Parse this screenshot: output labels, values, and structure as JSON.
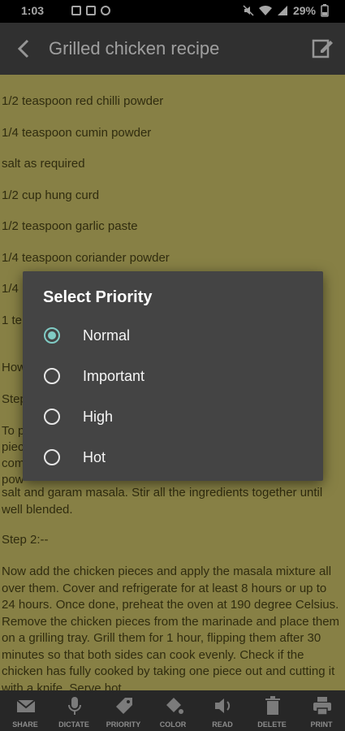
{
  "status_bar": {
    "time": "1:03",
    "battery": "29%"
  },
  "app_bar": {
    "title": "Grilled chicken recipe"
  },
  "content": {
    "lines": [
      "1/2 teaspoon red chilli powder",
      "1/4 teaspoon cumin powder",
      "salt as required",
      "1/2 cup hung curd",
      "1/2 teaspoon garlic paste",
      "1/4 teaspoon coriander powder",
      "1/4",
      "1 te",
      "How",
      "Step",
      "To p",
      "piec",
      "com",
      "pow"
    ],
    "paragraph1": "salt and garam masala. Stir all the ingredients together until well blended.",
    "step2_heading": "Step 2:--",
    "paragraph2": "Now add the chicken pieces and apply the masala mixture all over them. Cover and refrigerate for at least 8 hours or up to 24 hours. Once done, preheat the oven at 190 degree Celsius. Remove the chicken pieces from the marinade and place them on a grilling tray. Grill them for 1 hour, flipping them after 30 minutes so that both sides can cook evenly. Check if the chicken has fully cooked by taking one piece out and cutting it with a knife. Serve hot"
  },
  "dialog": {
    "title": "Select Priority",
    "options": [
      {
        "label": "Normal",
        "selected": true
      },
      {
        "label": "Important",
        "selected": false
      },
      {
        "label": "High",
        "selected": false
      },
      {
        "label": "Hot",
        "selected": false
      }
    ]
  },
  "bottom_bar": {
    "items": [
      {
        "label": "SHARE",
        "icon": "mail-icon"
      },
      {
        "label": "DICTATE",
        "icon": "microphone-icon"
      },
      {
        "label": "PRIORITY",
        "icon": "tag-icon"
      },
      {
        "label": "COLOR",
        "icon": "paint-bucket-icon"
      },
      {
        "label": "READ",
        "icon": "speaker-icon"
      },
      {
        "label": "DELETE",
        "icon": "trash-icon"
      },
      {
        "label": "PRINT",
        "icon": "printer-icon"
      }
    ]
  },
  "colors": {
    "note_background": "#cfc56a",
    "accent": "#80cbc4",
    "dialog_background": "#444444",
    "app_bar": "#4b4b4b"
  }
}
